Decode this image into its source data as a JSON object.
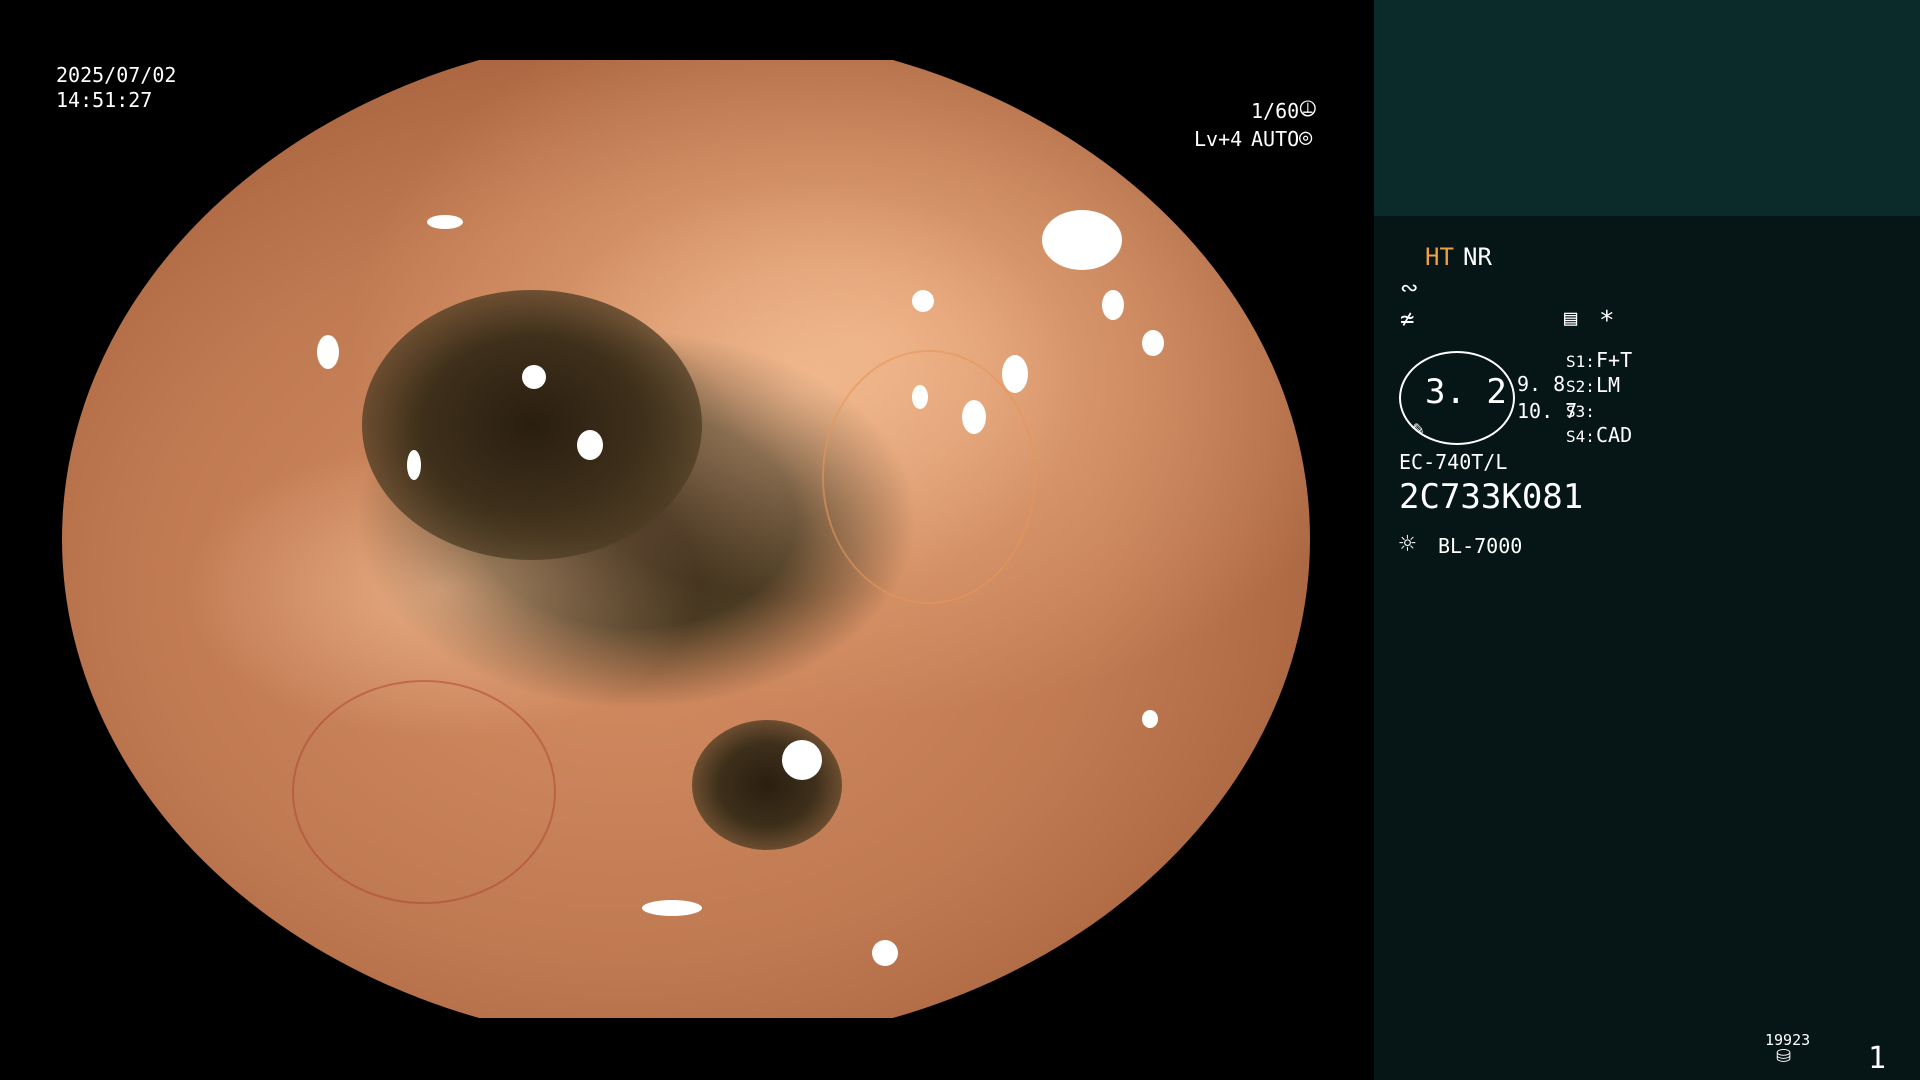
{
  "overlay": {
    "date": "2025/07/02",
    "time": "14:51:27",
    "shutter": "1/60",
    "level": "Lv+4",
    "mode": "AUTO"
  },
  "panel": {
    "ht": "HT",
    "nr": "NR",
    "icon_asterisk": "*",
    "magnification": "3. 2",
    "val1": "9. 8",
    "val2": "10. 7",
    "s1_key": "S1:",
    "s1_val": "F+T",
    "s2_key": "S2:",
    "s2_val": "LM",
    "s3_key": "S3:",
    "s3_val": "",
    "s4_key": "S4:",
    "s4_val": "CAD",
    "scope_model": "EC-740T/L",
    "serial": "2C733K081",
    "light_source": "BL-7000",
    "storage_count": "19923",
    "image_number": "1"
  },
  "colors": {
    "ht_accent": "#f0a040",
    "panel_bg": "#061515",
    "panel_top_bg": "#0b2a2a"
  },
  "icons": {
    "shutter": "aperture-icon",
    "mode": "iris-icon",
    "enhance": "enhance-curve-icon",
    "color": "color-tone-icon",
    "menu": "list-icon",
    "light": "sun-icon",
    "storage": "disk-stack-icon"
  }
}
